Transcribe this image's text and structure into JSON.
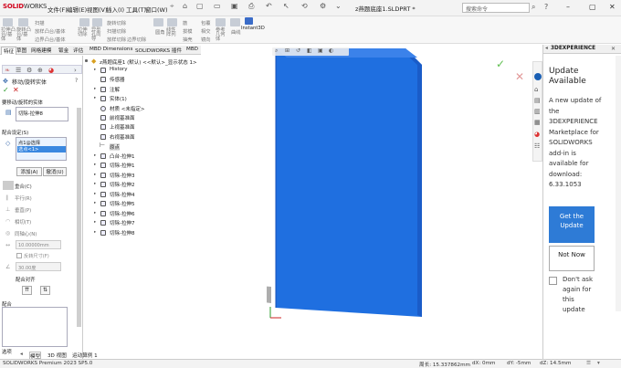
{
  "app": {
    "logo_brand": "SOLID",
    "logo_rest": "WORKS",
    "document_title": "z燕题底座1.SLDPRT *",
    "search_placeholder": "搜索命令"
  },
  "menus": [
    "文件(F)",
    "编辑(E)",
    "视图(V)",
    "插入(I)",
    "工具(T)",
    "窗口(W)"
  ],
  "ribbon": {
    "items": [
      "拉伸凸台/基体",
      "旋转凸台/基体",
      "扫描",
      "放样凸台/基体",
      "边界凸台/基体",
      "拉伸切除",
      "异型孔向导",
      "旋转切除",
      "扫描切除",
      "放样切除",
      "边界切除",
      "圆角",
      "线性阵列",
      "筋",
      "拔模",
      "抽壳",
      "包覆",
      "相交",
      "镜向",
      "参考几何体",
      "曲线",
      "Instant3D"
    ]
  },
  "feature_tabs": [
    "特征",
    "草图",
    "网格建模",
    "钣金",
    "评估",
    "MBD Dimensions",
    "SOLIDWORKS 插件",
    "MBD"
  ],
  "property_manager": {
    "title": "移动/旋转实体",
    "section_bodies": "要移动/旋转的实体",
    "body_item": "切除-拉伸8",
    "section_mates": "配合设定(S)",
    "mate_list": [
      "点1@选择",
      "选点<1>"
    ],
    "add_button": "添加(A)",
    "cancel_button": "撤消(U)",
    "mate_types": [
      "重合(C)",
      "平行(R)",
      "垂直(P)",
      "相切(T)",
      "同轴心(N)",
      "距离"
    ],
    "distance_value": "10.00000mm",
    "flip_dimension": "反转尺寸(F)",
    "angle_value": "30.00度",
    "mate_alignment": "配合对齐",
    "section_mates2": "配合",
    "options_label": "选项"
  },
  "feature_tree": {
    "root": "z燕题底座1 (默认) <<默认>_显示状态 1>",
    "items": [
      "History",
      "传感器",
      "注解",
      "实体(1)",
      "材质 <未指定>",
      "前视基准面",
      "上视基准面",
      "右视基准面",
      "原点",
      "凸台-拉伸1",
      "切除-拉伸1",
      "切除-拉伸3",
      "切除-拉伸2",
      "切除-拉伸4",
      "切除-拉伸5",
      "切除-拉伸6",
      "切除-拉伸7",
      "切除-拉伸8"
    ]
  },
  "view": {
    "part_color": "#1f6fe0",
    "edge_color": "#1a55c4",
    "shadow_color": "#8a8a8a"
  },
  "taskpane": {
    "header": "3DEXPERIENCE",
    "heading": "Update Available",
    "body": "A new update of the 3DEXPERIENCE Marketplace for SOLIDWORKS add-in is available for download: 6.33.1053",
    "get_button": "Get the Update",
    "not_now_button": "Not Now",
    "dont_ask": "Don't ask again for this update"
  },
  "bottom_tabs": [
    "模型",
    "3D 视图",
    "运动算例 1"
  ],
  "status": {
    "product": "SOLIDWORKS Premium 2023 SP5.0",
    "perimeter": "周长: 15.337862mm",
    "dx": "dX: 0mm",
    "dy": "dY: -5mm",
    "dz": "dZ: 14.5mm"
  },
  "colors": {
    "accent": "#2e7bd6",
    "brand": "#d0021b"
  }
}
